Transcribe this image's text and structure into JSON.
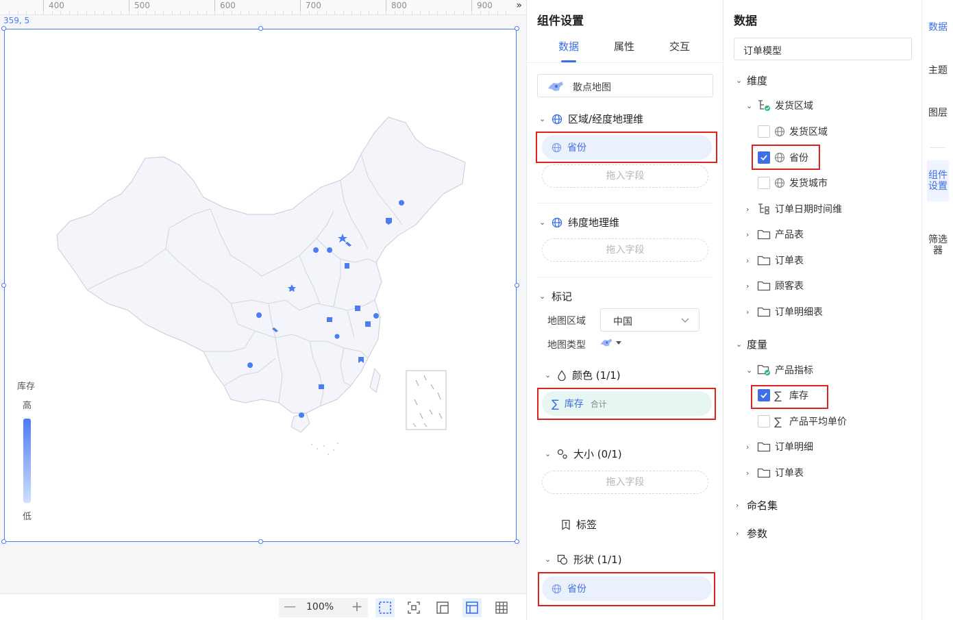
{
  "canvas": {
    "ruler_labels": [
      "400",
      "500",
      "600",
      "700",
      "800",
      "900"
    ],
    "coord_readout": "359, 5",
    "legend": {
      "title": "库存",
      "high_label": "高",
      "low_label": "低"
    },
    "zoom_level": "100%"
  },
  "settings": {
    "title": "组件设置",
    "tabs": [
      "数据",
      "属性",
      "交互"
    ],
    "active_tab": "数据",
    "chart_type": "散点地图",
    "region_dim": {
      "label": "区域/经度地理维",
      "field": "省份",
      "dropzone": "拖入字段"
    },
    "lat_dim": {
      "label": "纬度地理维",
      "dropzone": "拖入字段"
    },
    "marks": {
      "label": "标记",
      "map_region_label": "地图区域",
      "map_region_value": "中国",
      "map_type_label": "地图类型",
      "color": {
        "label": "颜色 (1/1)",
        "field": "库存",
        "agg": "合计"
      },
      "size": {
        "label": "大小 (0/1)",
        "dropzone": "拖入字段"
      },
      "tag": {
        "label": "标签"
      },
      "shape": {
        "label": "形状 (1/1)",
        "field": "省份"
      }
    }
  },
  "data": {
    "title": "数据",
    "model": "订单模型",
    "dimensions": {
      "label": "维度",
      "groups": [
        {
          "label": "发货区域",
          "children": [
            {
              "label": "发货区域",
              "checked": false
            },
            {
              "label": "省份",
              "checked": true
            },
            {
              "label": "发货城市",
              "checked": false
            }
          ]
        },
        {
          "label": "订单日期时间维"
        },
        {
          "label": "产品表"
        },
        {
          "label": "订单表"
        },
        {
          "label": "顾客表"
        },
        {
          "label": "订单明细表"
        }
      ]
    },
    "measures": {
      "label": "度量",
      "groups": [
        {
          "label": "产品指标",
          "children": [
            {
              "label": "库存",
              "checked": true
            },
            {
              "label": "产品平均单价",
              "checked": false
            }
          ]
        },
        {
          "label": "订单明细"
        },
        {
          "label": "订单表"
        }
      ]
    },
    "named_sets": "命名集",
    "params": "参数"
  },
  "rail": {
    "tabs": [
      "数据",
      "主题",
      "图层",
      "组件设置",
      "筛选器"
    ],
    "active": "组件设置"
  },
  "colors": {
    "accent": "#3d6fe6",
    "highlight": "#e0201b",
    "map_fill": "#f4f5fb",
    "map_stroke": "#c9ccd6"
  }
}
